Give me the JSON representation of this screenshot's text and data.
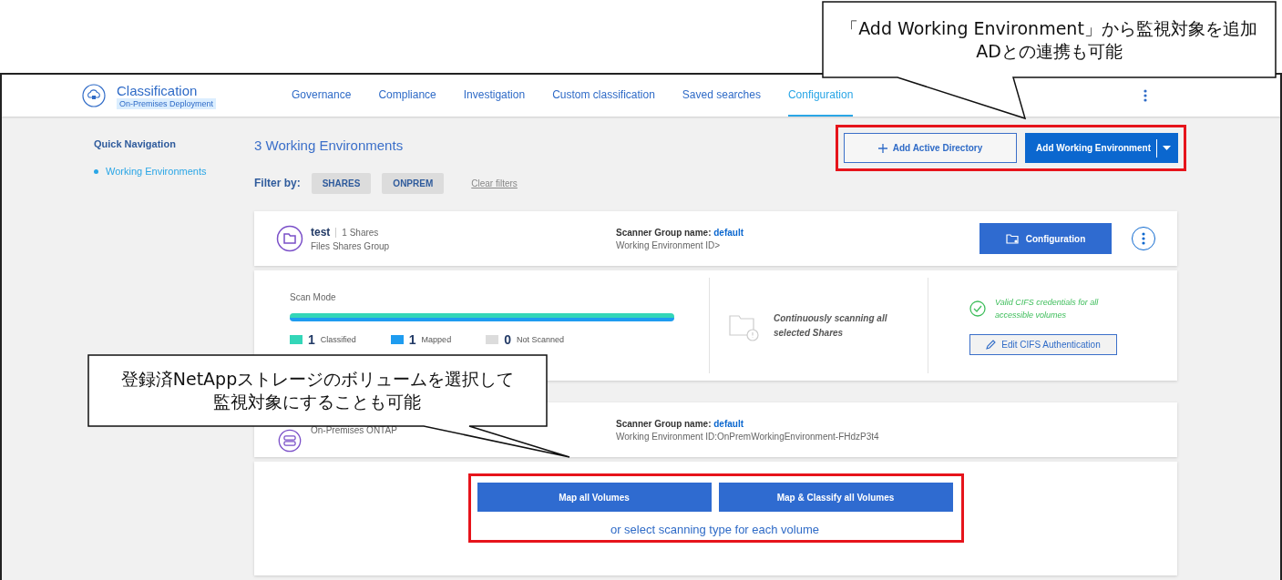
{
  "app": {
    "title": "Classification",
    "subtitle": "On-Premises Deployment"
  },
  "nav": [
    {
      "label": "Governance",
      "selected": false
    },
    {
      "label": "Compliance",
      "selected": false
    },
    {
      "label": "Investigation",
      "selected": false
    },
    {
      "label": "Custom classification",
      "selected": false
    },
    {
      "label": "Saved searches",
      "selected": false
    },
    {
      "label": "Configuration",
      "selected": true
    }
  ],
  "sidebar": {
    "heading": "Quick Navigation",
    "items": [
      {
        "label": "Working Environments",
        "selected": true
      }
    ]
  },
  "main": {
    "heading": "3 Working Environments",
    "actions": [
      {
        "label": "Add Active Directory",
        "kind": "outline"
      },
      {
        "label": "Add Working Environment",
        "kind": "split"
      }
    ],
    "filter": {
      "label": "Filter by:",
      "chips": [
        "SHARES",
        "ONPREM"
      ],
      "clear": "Clear filters"
    }
  },
  "environments": [
    {
      "kind": "shares",
      "name": "test",
      "count": "1 Shares",
      "type": "Files Shares Group",
      "scanner_label": "Scanner Group name:",
      "scanner": "default",
      "id": "Working Environment ID>",
      "button": "Configuration",
      "scan_mode": "Scan Mode",
      "scan_bar": {
        "level": 1
      },
      "legend": [
        {
          "count": "1",
          "label": "Classified",
          "color": "#33d6b8"
        },
        {
          "count": "1",
          "label": "Mapped",
          "color": "#1e9cf0"
        },
        {
          "count": "0",
          "label": "Not Scanned",
          "color": "#dcdcdc"
        }
      ],
      "status": "Continuously scanning all selected Shares",
      "credentials": "Valid CIFS credentials for all accessible volumes",
      "auth_button": "Edit CIFS Authentication"
    },
    {
      "kind": "ontap",
      "type": "On-Premises ONTAP",
      "scanner_label": "Scanner Group name:",
      "scanner": "default",
      "id": "Working Environment ID:OnPremWorkingEnvironment-FHdzP3t4",
      "actions": [
        "Map all Volumes",
        "Map & Classify all Volumes"
      ],
      "link": "or select scanning type for each volume"
    }
  ],
  "callouts": [
    {
      "lines": [
        "「Add Working Environment」から監視対象を追加",
        "ADとの連携も可能"
      ]
    },
    {
      "lines": [
        "登録済NetAppストレージのボリュームを選択して",
        "監視対象にすることも可能"
      ]
    }
  ]
}
